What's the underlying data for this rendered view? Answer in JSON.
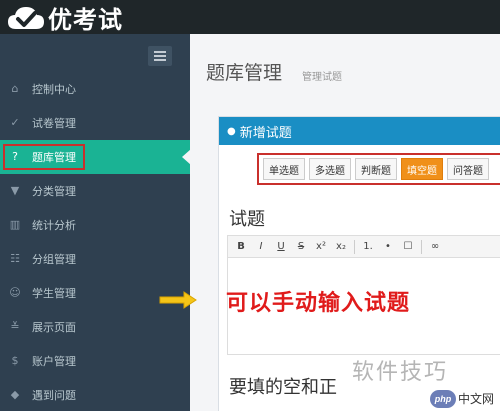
{
  "app": {
    "logo_text": "优考试"
  },
  "sidebar": {
    "items": [
      {
        "label": "控制中心",
        "icon": "home-icon"
      },
      {
        "label": "试卷管理",
        "icon": "check-circle-icon"
      },
      {
        "label": "题库管理",
        "icon": "question-circle-icon",
        "active": true
      },
      {
        "label": "分类管理",
        "icon": "filter-icon"
      },
      {
        "label": "统计分析",
        "icon": "bar-chart-icon"
      },
      {
        "label": "分组管理",
        "icon": "group-icon"
      },
      {
        "label": "学生管理",
        "icon": "user-icon"
      },
      {
        "label": "展示页面",
        "icon": "layers-icon"
      },
      {
        "label": "账户管理",
        "icon": "dollar-icon"
      },
      {
        "label": "遇到问题",
        "icon": "question-icon"
      }
    ]
  },
  "page": {
    "title": "题库管理",
    "subtitle": "管理试题"
  },
  "panel": {
    "title": "新增试题",
    "question_types": [
      "单选题",
      "多选题",
      "判断题",
      "填空题",
      "问答题"
    ],
    "selected_type": "填空题",
    "field_label": "试题",
    "field_label_2": "要填的空和正",
    "editor_toolbar": [
      "B",
      "I",
      "U",
      "S",
      "x²",
      "x₂",
      "1.",
      "•",
      "☐",
      "∞"
    ]
  },
  "annotation": {
    "hint": "可以手动输入试题"
  },
  "watermark": {
    "text": "软件技巧",
    "badge_logo": "php",
    "badge_site": "中文网"
  },
  "colors": {
    "sidebar": "#2f4050",
    "active": "#1ab394",
    "panel_header": "#1a8ec4",
    "selected_type": "#f0901a",
    "highlight": "#c9302c",
    "hint": "#e01b1b"
  }
}
